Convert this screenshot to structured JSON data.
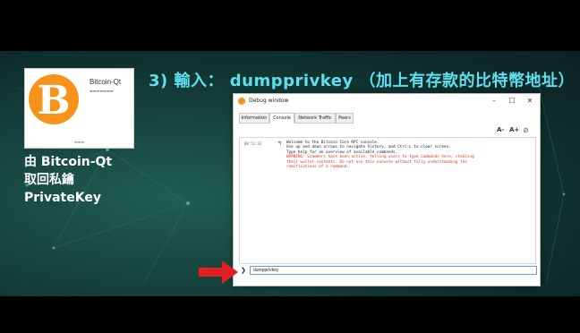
{
  "slide": {
    "title": "3) 輸入： dumpprivkey （加上有存款的比特幣地址）",
    "caption": [
      "由 Bitcoin-Qt",
      "取回私鑰",
      "PrivateKey"
    ],
    "thumbnail": {
      "brand": "Bitcoin-Qt",
      "coin_glyph": "B"
    }
  },
  "window": {
    "title": "Debug window",
    "controls": {
      "minimize": "–",
      "maximize": "☐",
      "close": "✕"
    },
    "tabs": [
      {
        "label": "Information",
        "active": false
      },
      {
        "label": "Console",
        "active": true
      },
      {
        "label": "Network Traffic",
        "active": false
      },
      {
        "label": "Peers",
        "active": false
      }
    ],
    "font_controls": {
      "decrease": "A-",
      "increase": "A+"
    }
  },
  "console": {
    "timestamp": "09:51:33",
    "lines": [
      {
        "text": "Welcome to the Bitcoin Core RPC console.",
        "warning": false
      },
      {
        "text": "Use up and down arrows to navigate history, and Ctrl-L to clear screen.",
        "warning": false
      },
      {
        "text": "Type help for an overview of available commands.",
        "warning": false
      },
      {
        "text": "WARNING: Scammers have been active, telling users to type commands here, stealing",
        "warning": true
      },
      {
        "text": "their wallet contents. Do not use this console without fully understanding the",
        "warning": true
      },
      {
        "text": "ramifications of a command.",
        "warning": true
      }
    ],
    "input_value": "dumpprivkey",
    "prompt": "❯"
  },
  "colors": {
    "title": "#5fe0f0",
    "bitcoin_orange": "#f7931a",
    "warning": "#e0301e",
    "arrow": "#e02020"
  }
}
